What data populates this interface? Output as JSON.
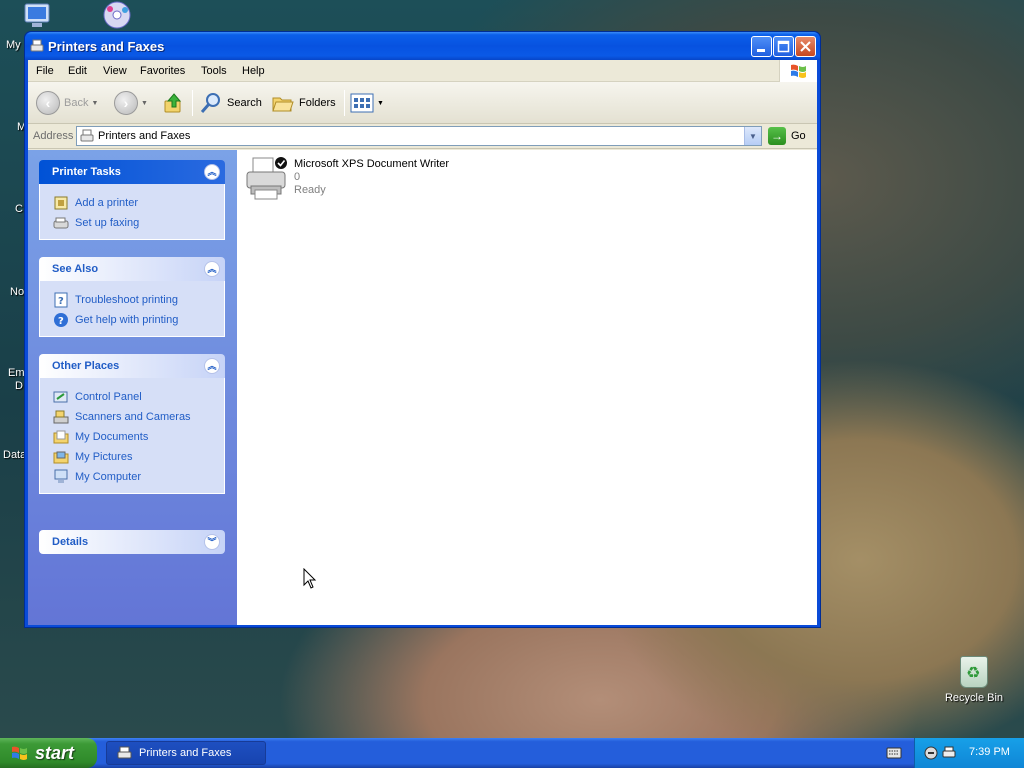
{
  "desktop": {
    "icons": [
      {
        "label": "My"
      },
      {
        "label": "M"
      },
      {
        "label": "C"
      },
      {
        "label": "No"
      },
      {
        "label": "Em"
      },
      {
        "label": "D"
      },
      {
        "label": "Data"
      }
    ],
    "recycle_bin": "Recycle Bin"
  },
  "window": {
    "title": "Printers and Faxes",
    "menu": [
      "File",
      "Edit",
      "View",
      "Favorites",
      "Tools",
      "Help"
    ],
    "toolbar": {
      "back": "Back",
      "search": "Search",
      "folders": "Folders"
    },
    "address": {
      "label": "Address",
      "value": "Printers and Faxes",
      "go": "Go"
    },
    "panels": [
      {
        "title": "Printer Tasks",
        "links": [
          "Add a printer",
          "Set up faxing"
        ]
      },
      {
        "title": "See Also",
        "links": [
          "Troubleshoot printing",
          "Get help with printing"
        ]
      },
      {
        "title": "Other Places",
        "links": [
          "Control Panel",
          "Scanners and Cameras",
          "My Documents",
          "My Pictures",
          "My Computer"
        ]
      },
      {
        "title": "Details",
        "links": []
      }
    ],
    "printer": {
      "name": "Microsoft XPS Document Writer",
      "documents": "0",
      "status": "Ready"
    }
  },
  "taskbar": {
    "start": "start",
    "task": "Printers and Faxes",
    "clock": "7:39 PM"
  },
  "colors": {
    "titlebar": "#0752e0",
    "taskbar": "#245edb",
    "start_green": "#3c9a36",
    "link_blue": "#215dc6"
  }
}
